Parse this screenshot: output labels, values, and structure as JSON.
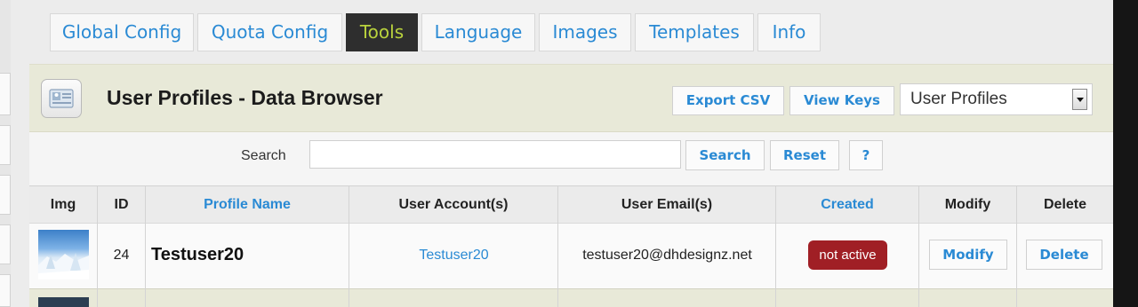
{
  "tabs": [
    {
      "label": "Global Config"
    },
    {
      "label": "Quota Config"
    },
    {
      "label": "Tools",
      "active": true
    },
    {
      "label": "Language"
    },
    {
      "label": "Images"
    },
    {
      "label": "Templates"
    },
    {
      "label": "Info"
    }
  ],
  "header": {
    "title": "User Profiles - Data Browser",
    "icon": "profile-card-icon",
    "export_csv_label": "Export CSV",
    "view_keys_label": "View Keys",
    "selected_table": "User Profiles"
  },
  "search": {
    "label": "Search",
    "value": "",
    "search_button": "Search",
    "reset_button": "Reset",
    "help_button": "?"
  },
  "table": {
    "columns": [
      "Img",
      "ID",
      "Profile Name",
      "User Account(s)",
      "User Email(s)",
      "Created",
      "Modify",
      "Delete"
    ],
    "rows": [
      {
        "id": "24",
        "profile_name": "Testuser20",
        "account": "Testuser20",
        "email": "testuser20@dhdesignz.net",
        "created": "not active",
        "modify": "Modify",
        "delete": "Delete"
      }
    ]
  },
  "colors": {
    "link": "#2a8ad4",
    "active_tab_bg": "#2e2e2e",
    "active_tab_text": "#b9d23d",
    "header_bg": "#e8e9d8",
    "badge_bg": "#a01f25"
  }
}
